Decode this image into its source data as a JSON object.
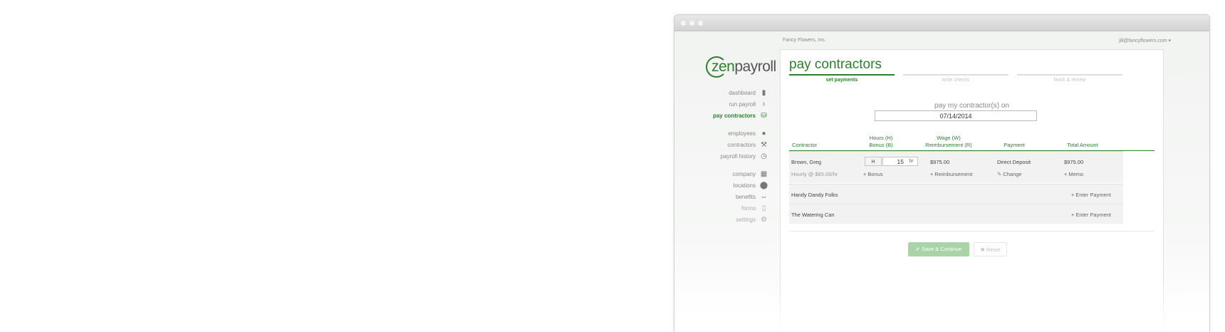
{
  "company_name": "Fancy Flowers, Inc.",
  "user_email": "jill@fancyflowers.com",
  "user_menu_caret": "▾",
  "logo": {
    "part1": "zen",
    "part2": "payroll"
  },
  "colors": {
    "accent": "#2f7d2f",
    "save_button": "#a8d4a8"
  },
  "nav": [
    {
      "label": "dashboard",
      "icon": "bar-chart-icon",
      "glyph": "▮"
    },
    {
      "label": "run payroll",
      "icon": "money-bag-icon",
      "glyph": "♁"
    },
    {
      "label": "pay contractors",
      "icon": "cash-icon",
      "glyph": "⛁"
    },
    {
      "label": "employees",
      "icon": "person-icon",
      "glyph": "●"
    },
    {
      "label": "contractors",
      "icon": "hammer-icon",
      "glyph": "⚒"
    },
    {
      "label": "payroll history",
      "icon": "clock-icon",
      "glyph": "◷"
    },
    {
      "label": "company",
      "icon": "building-icon",
      "glyph": "▦"
    },
    {
      "label": "locations",
      "icon": "map-pin-icon",
      "glyph": "⬤"
    },
    {
      "label": "benefits",
      "icon": "dumbbell-icon",
      "glyph": "⇔"
    },
    {
      "label": "forms",
      "icon": "document-icon",
      "glyph": "▯"
    },
    {
      "label": "settings",
      "icon": "gear-icon",
      "glyph": "⚙"
    }
  ],
  "page": {
    "title": "pay contractors",
    "steps": [
      "set payments",
      "write checks",
      "finish & review"
    ],
    "pay_on_label": "pay my contractor(s) on",
    "pay_date": "07/14/2014"
  },
  "table": {
    "headers": {
      "contractor": "Contractor",
      "hours": "Hours (H)",
      "bonus": "Bonus (B)",
      "wage": "Wage (W)",
      "reimbursement": "Reimbursement (R)",
      "payment": "Payment",
      "total": "Total Amount"
    },
    "expanded_row": {
      "name": "Brown, Greg",
      "rate": "Hourly @ $65.00/hr",
      "type_toggle": "H",
      "hours_value": "15",
      "hours_unit": "hr",
      "wage": "$975.00",
      "payment_method": "Direct Deposit",
      "total": "$975.00",
      "bonus_link": "Bonus",
      "reimbursement_link": "Reimbursement",
      "change_link": "Change",
      "memo_link": "Memo"
    },
    "rows": [
      {
        "name": "Handy Dandy Folks",
        "action": "Enter Payment"
      },
      {
        "name": "The Watering Can",
        "action": "Enter Payment"
      }
    ]
  },
  "buttons": {
    "save_continue": "Save & Continue",
    "reset": "Reset",
    "save_icon": "✔",
    "reset_icon": "✖"
  }
}
